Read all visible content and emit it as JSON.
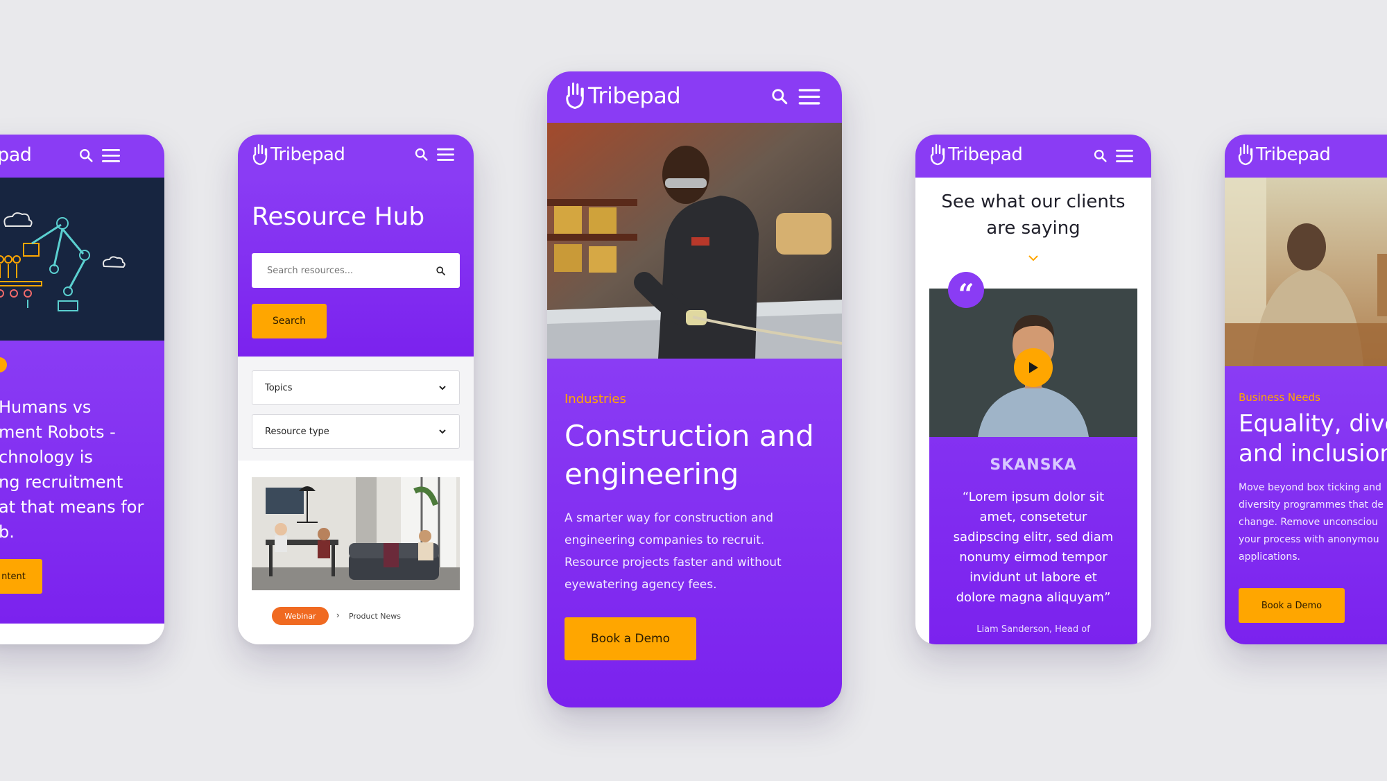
{
  "brand": {
    "name": "Tribepad",
    "color_primary": "#8a3cf4",
    "color_accent": "#ffa600",
    "color_badge": "#f06a21",
    "icons": [
      "hand-logo-icon",
      "search-icon",
      "menu-icon"
    ]
  },
  "screen1": {
    "header_title_visible": "epad",
    "heading_lines": [
      "Humans vs",
      "ment Robots -",
      "chnology is",
      "ng recruitment",
      "at that means for",
      "b."
    ],
    "button_label": "ntent"
  },
  "screen2": {
    "title": "Resource Hub",
    "search_placeholder": "Search resources...",
    "search_button": "Search",
    "filters": [
      "Topics",
      "Resource type"
    ],
    "card": {
      "badge": "Webinar",
      "category": "Product News"
    }
  },
  "screen3": {
    "eyebrow": "Industries",
    "title_lines": [
      "Construction and",
      "engineering"
    ],
    "body_lines": [
      "A smarter way for construction and",
      "engineering companies to recruit.",
      "Resource projects faster and without",
      "eyewatering agency fees."
    ],
    "cta": "Book a Demo"
  },
  "screen4": {
    "heading_lines": [
      "See what our clients",
      "are saying"
    ],
    "company": "SKANSKA",
    "quote_lines": [
      "“Lorem ipsum dolor sit",
      "amet, consetetur",
      "sadipscing elitr, sed diam",
      "nonumy eirmod tempor",
      "invidunt ut labore et",
      "dolore magna aliquyam”"
    ],
    "attribution": "Liam Sanderson, Head of"
  },
  "screen5": {
    "eyebrow": "Business Needs",
    "title_lines": [
      "Equality, dive",
      "and inclusion"
    ],
    "body_lines": [
      "Move beyond box ticking and",
      "diversity programmes that de",
      "change. Remove unconsciou",
      "your process with anonymou",
      "applications."
    ],
    "cta": "Book a Demo"
  }
}
